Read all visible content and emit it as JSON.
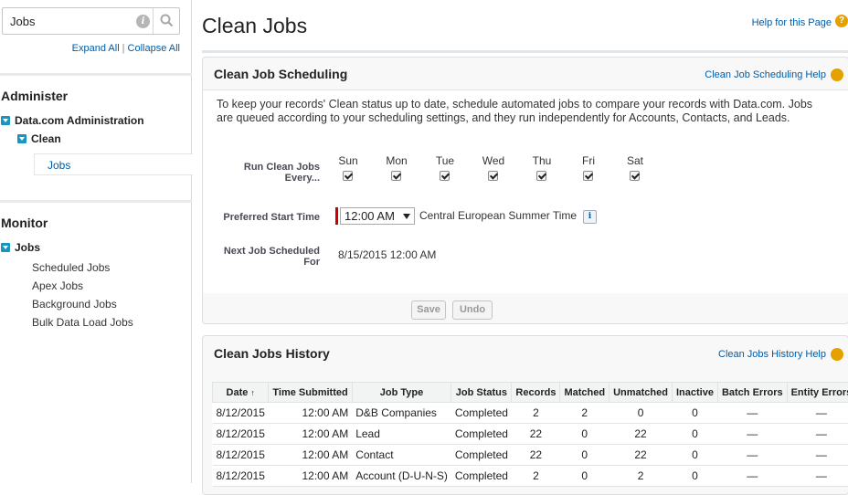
{
  "sidebar": {
    "search_value": "Jobs",
    "expand_all": "Expand All",
    "separator": "|",
    "collapse_all": "Collapse All",
    "administer": {
      "heading": "Administer",
      "root": "Data.com Administration",
      "child": "Clean",
      "selected": "Jobs"
    },
    "monitor": {
      "heading": "Monitor",
      "root": "Jobs",
      "links": [
        "Scheduled Jobs",
        "Apex Jobs",
        "Background Jobs",
        "Bulk Data Load Jobs"
      ]
    }
  },
  "header": {
    "title": "Clean Jobs",
    "help_link": "Help for this Page",
    "help_icon": "?"
  },
  "scheduling": {
    "title": "Clean Job Scheduling",
    "help_link": "Clean Job Scheduling Help",
    "intro": "To keep your records' Clean status up to date, schedule automated jobs to compare your records with Data.com. Jobs are queued according to your scheduling settings, and they run independently for Accounts, Contacts, and Leads.",
    "run_label": "Run Clean Jobs Every...",
    "days": [
      "Sun",
      "Mon",
      "Tue",
      "Wed",
      "Thu",
      "Fri",
      "Sat"
    ],
    "days_checked": [
      true,
      true,
      true,
      true,
      true,
      true,
      true
    ],
    "start_label": "Preferred Start Time",
    "start_time": "12:00 AM",
    "timezone": "Central European Summer Time",
    "info_icon": "i",
    "next_label": "Next Job Scheduled For",
    "next_value": "8/15/2015 12:00 AM",
    "save": "Save",
    "undo": "Undo"
  },
  "history": {
    "title": "Clean Jobs History",
    "help_link": "Clean Jobs History Help",
    "columns": [
      "Date",
      "Time Submitted",
      "Job Type",
      "Job Status",
      "Records",
      "Matched",
      "Unmatched",
      "Inactive",
      "Batch Errors",
      "Entity Errors"
    ],
    "sort_icon": "↑",
    "rows": [
      [
        "8/12/2015",
        "12:00 AM",
        "D&B Companies",
        "Completed",
        "2",
        "2",
        "0",
        "0",
        "—",
        "—"
      ],
      [
        "8/12/2015",
        "12:00 AM",
        "Lead",
        "Completed",
        "22",
        "0",
        "22",
        "0",
        "—",
        "—"
      ],
      [
        "8/12/2015",
        "12:00 AM",
        "Contact",
        "Completed",
        "22",
        "0",
        "22",
        "0",
        "—",
        "—"
      ],
      [
        "8/12/2015",
        "12:00 AM",
        "Account (D-U-N-S)",
        "Completed",
        "2",
        "0",
        "2",
        "0",
        "—",
        "—"
      ]
    ]
  },
  "colors": {
    "link": "#015ba7",
    "tree_toggle": "#1797c0",
    "help_icon": "#e4a100",
    "required": "#cc0000"
  }
}
